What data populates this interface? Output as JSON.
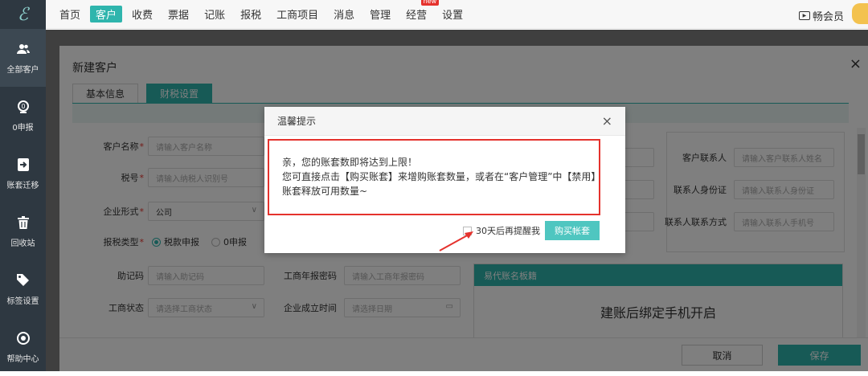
{
  "logo": "ℰ",
  "sidebar": {
    "items": [
      {
        "label": "全部客户",
        "icon": "users-icon"
      },
      {
        "label": "0申报",
        "icon": "zero-report-icon"
      },
      {
        "label": "账套迁移",
        "icon": "migrate-icon"
      },
      {
        "label": "回收站",
        "icon": "trash-icon"
      },
      {
        "label": "标签设置",
        "icon": "tag-icon"
      },
      {
        "label": "帮助中心",
        "icon": "help-icon"
      }
    ]
  },
  "nav": {
    "items": [
      "首页",
      "客户",
      "收费",
      "票据",
      "记账",
      "报税",
      "工商项目",
      "消息",
      "管理",
      "经营",
      "设置"
    ],
    "badge": "new",
    "vip": "畅会员"
  },
  "form_dialog": {
    "title": "新建客户",
    "close": "×",
    "tabs": [
      "基本信息",
      "财税设置"
    ],
    "fields": {
      "customer_name": {
        "label": "客户名称",
        "placeholder": "请输入客户名称"
      },
      "tax_no": {
        "label": "税号",
        "placeholder": "请输入纳税人识别号"
      },
      "company_type": {
        "label": "企业形式",
        "value": "公司"
      },
      "tax_type": {
        "label": "报税类型",
        "opt1": "税款申报",
        "opt2": "0申报"
      },
      "mnemonic": {
        "label": "助记码",
        "placeholder": "请输入助记码"
      },
      "biz_status": {
        "label": "工商状态",
        "placeholder": "请选择工商状态"
      },
      "annual_pwd": {
        "label": "工商年报密码",
        "placeholder": "请输入工商年报密码"
      },
      "found_date": {
        "label": "企业成立时间",
        "placeholder": "请选择日期"
      },
      "contact": {
        "label": "客户联系人",
        "placeholder": "请输入客户联系人姓名"
      },
      "contact_id": {
        "label": "联系人身份证",
        "placeholder": "请输入联系人身份证"
      },
      "contact_phone": {
        "label": "联系人联系方式",
        "placeholder": "请输入联系人手机号"
      }
    },
    "board_title": "易代账名板籍",
    "board_text": "建账后绑定手机开启",
    "cancel": "取消",
    "save": "保存"
  },
  "modal": {
    "title": "温馨提示",
    "close": "×",
    "line1": "亲，您的账套数即将达到上限！",
    "line2": "您可直接点击【购买账套】来增购账套数量，或者在“客户管理”中【禁用】",
    "line3": "账套释放可用数量~",
    "remind": "30天后再提醒我",
    "buy": "购买帐套"
  }
}
